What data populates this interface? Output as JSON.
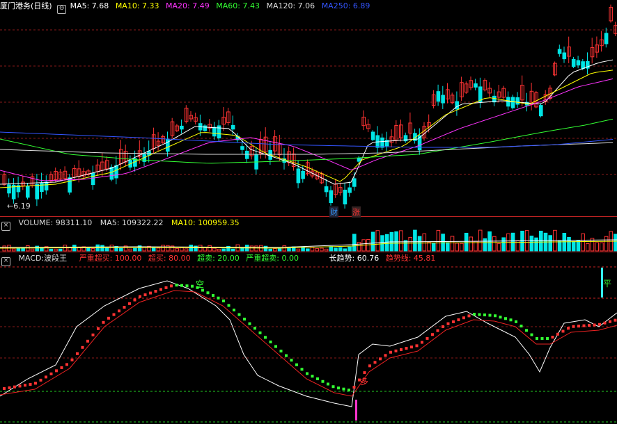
{
  "price_panel": {
    "title": "厦门港务(日线)",
    "ma": [
      {
        "label": "MA5: 7.68",
        "color": "#ffffff"
      },
      {
        "label": "MA10: 7.33",
        "color": "#ffff00"
      },
      {
        "label": "MA20: 7.49",
        "color": "#ff33ff"
      },
      {
        "label": "MA60: 7.43",
        "color": "#33ff33"
      },
      {
        "label": "MA120: 7.06",
        "color": "#dddddd"
      },
      {
        "label": "MA250: 6.89",
        "color": "#3355ff"
      }
    ],
    "low_label": "6.19",
    "markers": [
      {
        "text": "财",
        "color": "#3399ff"
      },
      {
        "text": "涨",
        "color": "#ff3333"
      }
    ]
  },
  "volume_panel": {
    "items": [
      {
        "label": "VOLUME: 98311.10",
        "color": "#dddddd"
      },
      {
        "label": "MA5: 109322.22",
        "color": "#dddddd"
      },
      {
        "label": "MA10: 100959.35",
        "color": "#ffff00"
      }
    ]
  },
  "macd_panel": {
    "name": "MACD:波段王",
    "items": [
      {
        "label": "严重超买: 100.00",
        "color": "#ff3333"
      },
      {
        "label": "超买: 80.00",
        "color": "#ff3333"
      },
      {
        "label": "超卖: 20.00",
        "color": "#33ff33"
      },
      {
        "label": "严重超卖: 0.00",
        "color": "#33ff33"
      },
      {
        "label": "长趋势: 60.76",
        "color": "#ffffff"
      },
      {
        "label": "趋势线: 45.81",
        "color": "#ff3333"
      }
    ],
    "annotations": {
      "kong": "空",
      "ping": "平",
      "duo": "多"
    }
  },
  "colors": {
    "up": "#ff3333",
    "down": "#00e5e5",
    "grid": "#b22222"
  }
}
